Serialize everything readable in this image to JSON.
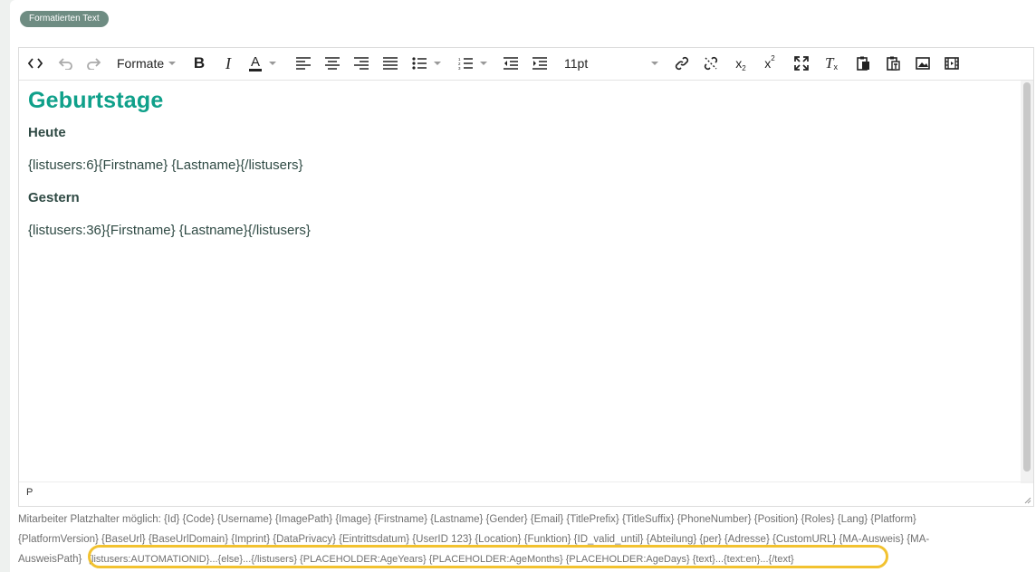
{
  "badge": "Formatierten Text",
  "toolbar": {
    "formats_label": "Formate",
    "font_size": "11pt"
  },
  "content": {
    "heading": "Geburtstage",
    "section1_title": "Heute",
    "section1_text": "{listusers:6}{Firstname} {Lastname}{/listusers}",
    "section2_title": "Gestern",
    "section2_text": "{listusers:36}{Firstname} {Lastname}{/listusers}"
  },
  "status_path": "P",
  "hint": {
    "line1": "Mitarbeiter Platzhalter möglich: {Id} {Code} {Username} {ImagePath} {Image} {Firstname} {Lastname} {Gender} {Email} {TitlePrefix} {TitleSuffix} {PhoneNumber} {Position} {Roles} {Lang} {Platform}",
    "line2": "{PlatformVersion} {BaseUrl} {BaseUrlDomain} {Imprint} {DataPrivacy} {Eintrittsdatum} {UserID 123} {Location} {Funktion} {ID_valid_until} {Abteilung} {per} {Adresse} {CustomURL} {MA-Ausweis} {MA-",
    "line3a": "AusweisPath}",
    "line3b": "{listusers:AUTOMATIONID}...{else}...{/listusers} {PLACEHOLDER:AgeYears} {PLACEHOLDER:AgeMonths} {PLACEHOLDER:AgeDays} {text}...{text:en}...{/text}"
  },
  "colors": {
    "heading": "#0fa08a",
    "badge": "#6e8c82",
    "highlight": "#f2c230"
  }
}
